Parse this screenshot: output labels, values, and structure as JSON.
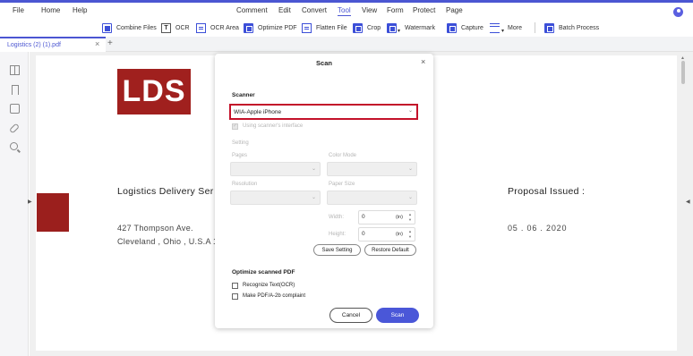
{
  "menu": [
    "File",
    "Home",
    "Help",
    "Comment",
    "Edit",
    "Convert",
    "Tool",
    "View",
    "Form",
    "Protect",
    "Page"
  ],
  "menu_active": "Tool",
  "toolbar": {
    "combine": "Combine Files",
    "ocr": "OCR",
    "ocr_area": "OCR Area",
    "optimize": "Optimize PDF",
    "flatten": "Flatten File",
    "crop": "Crop",
    "watermark": "Watermark",
    "capture": "Capture",
    "more": "More",
    "batch": "Batch Process"
  },
  "tab": {
    "label": "Logistics (2) (1).pdf",
    "close": "×",
    "add": "+"
  },
  "document": {
    "logo": "LDS",
    "title": "Logistics Delivery Ser",
    "address1": "427 Thompson Ave.",
    "address2": "Cleveland , Ohio , U.S.A 1",
    "proposal": "Proposal Issued :",
    "date": "05 . 06 . 2020"
  },
  "dialog": {
    "title": "Scan",
    "close": "×",
    "scanner_label": "Scanner",
    "scanner_value": "WIA-Apple iPhone",
    "use_interface": "Using scanner's interface",
    "settings_label": "Setting",
    "pages_label": "Pages",
    "color_mode_label": "Color Mode",
    "resolution_label": "Resolution",
    "paper_size_label": "Paper Size",
    "width_label": "Width:",
    "width_value": "0",
    "height_label": "Height:",
    "height_value": "0",
    "unit": "(in)",
    "save_setting": "Save Setting",
    "restore_default": "Restore Default",
    "optimize_label": "Optimize scanned PDF",
    "recognize_text": "Recognize Text(OCR)",
    "make_pdfa": "Make PDF/A-2b complaint",
    "cancel": "Cancel",
    "scan": "Scan"
  },
  "colors": {
    "accent": "#4b56d2",
    "brand": "#a0201e",
    "highlight": "#c3122a"
  }
}
